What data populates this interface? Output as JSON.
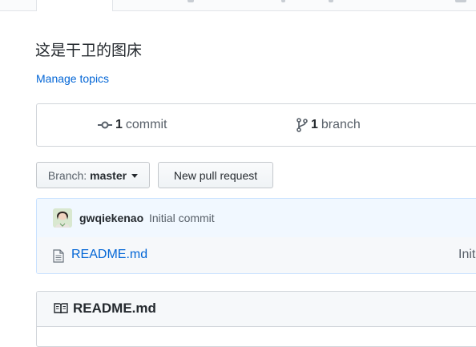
{
  "repo": {
    "description": "这是干卫的图床",
    "manage_topics": "Manage topics"
  },
  "summary": {
    "commits_count": "1",
    "commits_label": "commit",
    "branches_count": "1",
    "branches_label": "branch"
  },
  "toolbar": {
    "branch_label": "Branch:",
    "branch_value": "master",
    "new_pr": "New pull request"
  },
  "commit": {
    "author": "gwqiekenao",
    "message": "Initial commit"
  },
  "files": [
    {
      "name": "README.md",
      "message": "Initial commit"
    }
  ],
  "readme": {
    "title": "README.md"
  },
  "colors": {
    "link": "#0366d6",
    "commit_bar_bg": "#f1f8ff",
    "commit_bar_border": "#c8e1ff"
  }
}
